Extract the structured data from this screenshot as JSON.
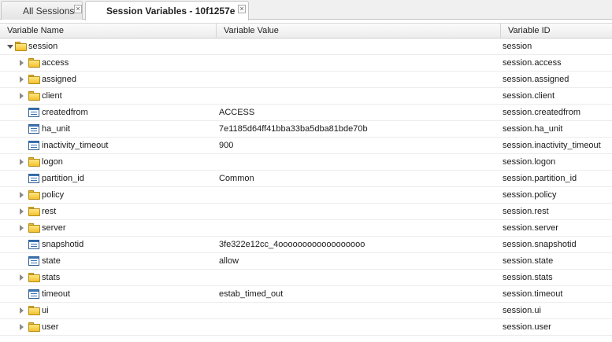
{
  "tabs": [
    {
      "label": "All Sessions",
      "active": false
    },
    {
      "label": "Session Variables - 10f1257e",
      "active": true
    }
  ],
  "columns": {
    "name": "Variable Name",
    "value": "Variable Value",
    "id": "Variable ID"
  },
  "rows": [
    {
      "name": "session",
      "value": "",
      "id": "session",
      "type": "folder",
      "level": 0,
      "expander": "expanded"
    },
    {
      "name": "access",
      "value": "",
      "id": "session.access",
      "type": "folder",
      "level": 1,
      "expander": "collapsed"
    },
    {
      "name": "assigned",
      "value": "",
      "id": "session.assigned",
      "type": "folder",
      "level": 1,
      "expander": "collapsed"
    },
    {
      "name": "client",
      "value": "",
      "id": "session.client",
      "type": "folder",
      "level": 1,
      "expander": "collapsed"
    },
    {
      "name": "createdfrom",
      "value": "ACCESS",
      "id": "session.createdfrom",
      "type": "variable",
      "level": 1,
      "expander": "none"
    },
    {
      "name": "ha_unit",
      "value": "7e1185d64ff41bba33ba5dba81bde70b",
      "id": "session.ha_unit",
      "type": "variable",
      "level": 1,
      "expander": "none"
    },
    {
      "name": "inactivity_timeout",
      "value": "900",
      "id": "session.inactivity_timeout",
      "type": "variable",
      "level": 1,
      "expander": "none"
    },
    {
      "name": "logon",
      "value": "",
      "id": "session.logon",
      "type": "folder",
      "level": 1,
      "expander": "collapsed"
    },
    {
      "name": "partition_id",
      "value": "Common",
      "id": "session.partition_id",
      "type": "variable",
      "level": 1,
      "expander": "none"
    },
    {
      "name": "policy",
      "value": "",
      "id": "session.policy",
      "type": "folder",
      "level": 1,
      "expander": "collapsed"
    },
    {
      "name": "rest",
      "value": "",
      "id": "session.rest",
      "type": "folder",
      "level": 1,
      "expander": "collapsed"
    },
    {
      "name": "server",
      "value": "",
      "id": "session.server",
      "type": "folder",
      "level": 1,
      "expander": "collapsed"
    },
    {
      "name": "snapshotid",
      "value": "3fe322e12cc_4oooooooooooooooooo",
      "id": "session.snapshotid",
      "type": "variable",
      "level": 1,
      "expander": "none"
    },
    {
      "name": "state",
      "value": "allow",
      "id": "session.state",
      "type": "variable",
      "level": 1,
      "expander": "none"
    },
    {
      "name": "stats",
      "value": "",
      "id": "session.stats",
      "type": "folder",
      "level": 1,
      "expander": "collapsed"
    },
    {
      "name": "timeout",
      "value": "estab_timed_out",
      "id": "session.timeout",
      "type": "variable",
      "level": 1,
      "expander": "none"
    },
    {
      "name": "ui",
      "value": "",
      "id": "session.ui",
      "type": "folder",
      "level": 1,
      "expander": "collapsed"
    },
    {
      "name": "user",
      "value": "",
      "id": "session.user",
      "type": "folder",
      "level": 1,
      "expander": "collapsed"
    }
  ]
}
